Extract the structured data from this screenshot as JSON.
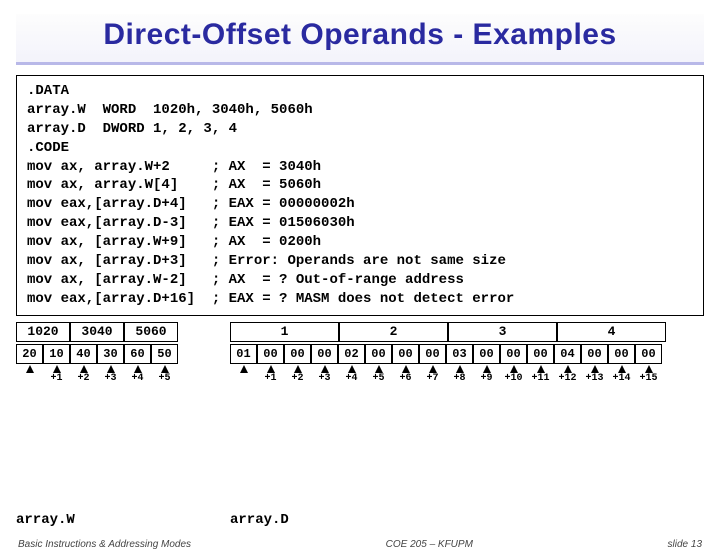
{
  "title": "Direct-Offset Operands - Examples",
  "code_lines": [
    ".DATA",
    "array.W  WORD  1020h, 3040h, 5060h",
    "array.D  DWORD 1, 2, 3, 4",
    ".CODE",
    "mov ax, array.W+2     ; AX  = 3040h",
    "mov ax, array.W[4]    ; AX  = 5060h",
    "mov eax,[array.D+4]   ; EAX = 00000002h",
    "mov eax,[array.D-3]   ; EAX = 01506030h",
    "mov ax, [array.W+9]   ; AX  = 0200h",
    "mov ax, [array.D+3]   ; Error: Operands are not same size",
    "mov ax, [array.W-2]   ; AX  = ? Out-of-range address",
    "mov eax,[array.D+16]  ; EAX = ? MASM does not detect error"
  ],
  "word_row": {
    "arrayW": [
      "1020",
      "3040",
      "5060"
    ],
    "arrayD": [
      "1",
      "2",
      "3",
      "4"
    ]
  },
  "byte_row": {
    "arrayW": [
      "20",
      "10",
      "40",
      "30",
      "60",
      "50"
    ],
    "arrayD": [
      "01",
      "00",
      "00",
      "00",
      "02",
      "00",
      "00",
      "00",
      "03",
      "00",
      "00",
      "00",
      "04",
      "00",
      "00",
      "00"
    ]
  },
  "offsets": {
    "arrayW": [
      "",
      "+1",
      "+2",
      "+3",
      "+4",
      "+5"
    ],
    "arrayD": [
      "",
      "+1",
      "+2",
      "+3",
      "+4",
      "+5",
      "+6",
      "+7",
      "+8",
      "+9",
      "+10",
      "+11",
      "+12",
      "+13",
      "+14",
      "+15"
    ]
  },
  "labels": {
    "arrayW": "array.W",
    "arrayD": "array.D"
  },
  "footer": {
    "left": "Basic Instructions & Addressing Modes",
    "mid": "COE 205 – KFUPM",
    "right": "slide 13"
  }
}
